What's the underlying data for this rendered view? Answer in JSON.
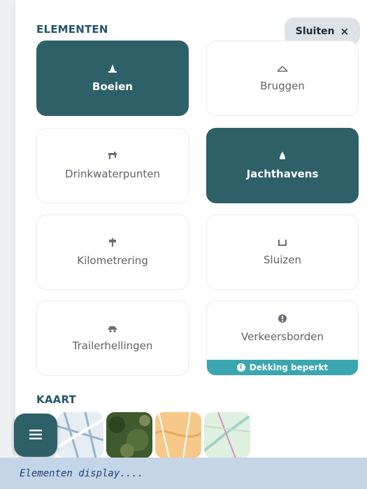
{
  "elements_section": {
    "title": "ELEMENTEN"
  },
  "close_button": {
    "label": "Sluiten",
    "icon": "×"
  },
  "cards": [
    {
      "label": "Boeien",
      "icon": "buoy-icon",
      "active": true
    },
    {
      "label": "Bruggen",
      "icon": "bridge-icon",
      "active": false
    },
    {
      "label": "Drinkwaterpunten",
      "icon": "faucet-icon",
      "active": false
    },
    {
      "label": "Jachthavens",
      "icon": "sailboat-icon",
      "active": true
    },
    {
      "label": "Kilometrering",
      "icon": "signpost-icon",
      "active": false
    },
    {
      "label": "Sluizen",
      "icon": "lock-icon",
      "active": false
    },
    {
      "label": "Trailerhellingen",
      "icon": "trailer-icon",
      "active": false
    },
    {
      "label": "Verkeersborden",
      "icon": "warning-icon",
      "active": false,
      "badge": "Dekking beperkt"
    }
  ],
  "map_section": {
    "title": "KAART",
    "thumbnails": [
      {
        "name": "street-map"
      },
      {
        "name": "satellite-map"
      },
      {
        "name": "topo-map"
      },
      {
        "name": "water-map"
      }
    ]
  },
  "menu_button": {
    "icon": "hamburger-icon"
  },
  "colors": {
    "accent": "#2e6068",
    "title": "#24556b",
    "badge": "#3aa6b0"
  },
  "caption": {
    "text": "Elementen display...."
  }
}
